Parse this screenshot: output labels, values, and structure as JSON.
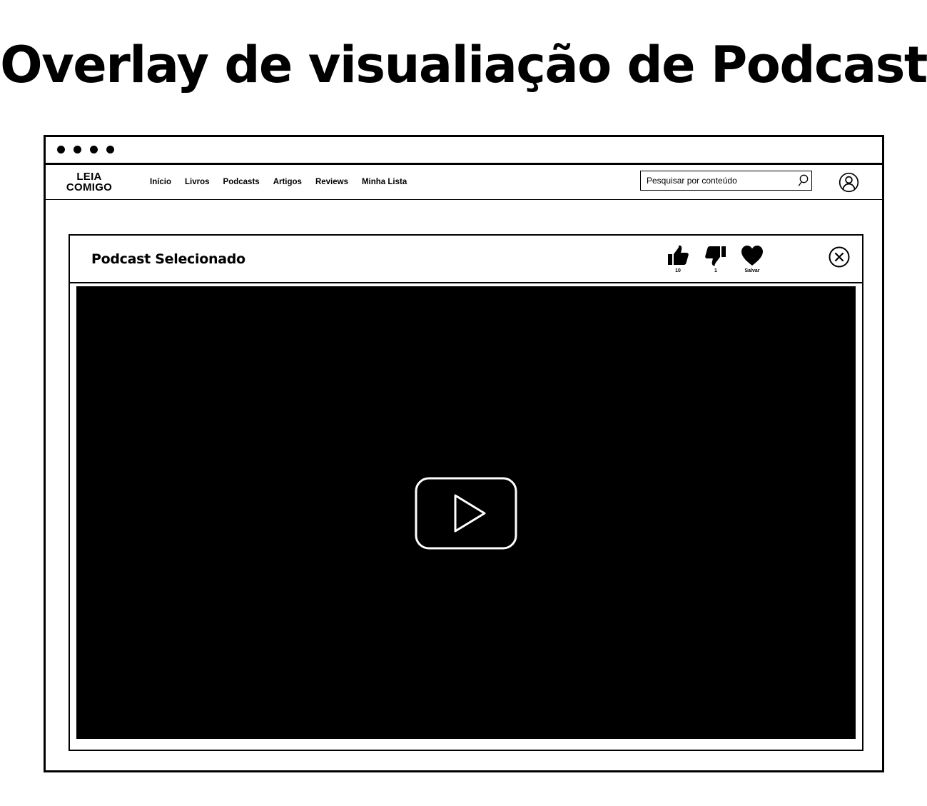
{
  "page_heading": "Overlay de visualiação de Podcast",
  "app": {
    "logo_line1": "LEIA",
    "logo_line2": "COMIGO",
    "nav": [
      {
        "label": "Início"
      },
      {
        "label": "Livros"
      },
      {
        "label": "Podcasts"
      },
      {
        "label": "Artigos"
      },
      {
        "label": "Reviews"
      },
      {
        "label": "Minha Lista"
      }
    ],
    "search": {
      "placeholder": "Pesquisar por conteúdo",
      "icon": "search-icon"
    },
    "profile_icon": "user-circle-icon"
  },
  "modal": {
    "title": "Podcast Selecionado",
    "actions": {
      "like": {
        "icon": "thumbs-up-icon",
        "count": "10"
      },
      "dislike": {
        "icon": "thumbs-down-icon",
        "count": "1"
      },
      "save": {
        "icon": "heart-icon",
        "label": "Salvar"
      }
    },
    "close_icon": "close-circle-icon",
    "player": {
      "background": "#000000",
      "play_icon": "play-icon"
    }
  },
  "colors": {
    "ink": "#000000",
    "paper": "#ffffff"
  }
}
